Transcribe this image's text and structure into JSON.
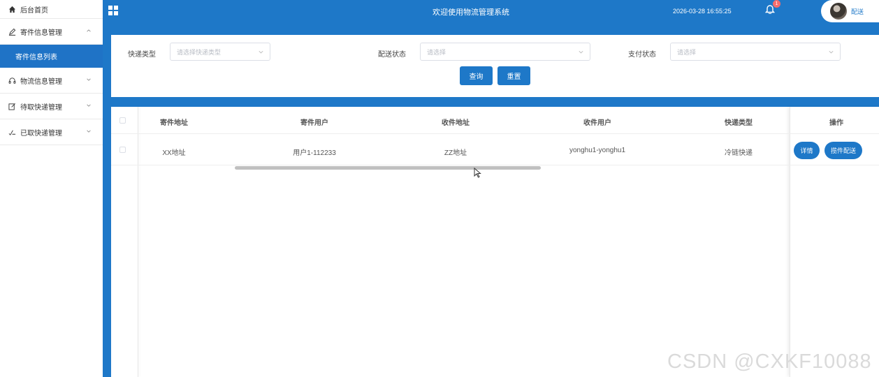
{
  "sidebar": {
    "home": "后台首页",
    "groups": [
      {
        "label": "寄件信息管理",
        "icon": "pen-icon",
        "expanded": true,
        "sub": "寄件信息列表"
      },
      {
        "label": "物流信息管理",
        "icon": "headset-icon"
      },
      {
        "label": "待取快递管理",
        "icon": "edit-icon"
      },
      {
        "label": "已取快递管理",
        "icon": "signature-icon"
      }
    ]
  },
  "header": {
    "title": "欢迎使用物流管理系统",
    "datetime": "2026-03-28 16:55:25",
    "badge": "1",
    "username": "配送"
  },
  "search": {
    "fields": [
      {
        "label": "快递类型",
        "placeholder": "请选择快递类型"
      },
      {
        "label": "配送状态",
        "placeholder": "请选择"
      },
      {
        "label": "支付状态",
        "placeholder": "请选择"
      }
    ],
    "query_btn": "查询",
    "reset_btn": "重置"
  },
  "table": {
    "columns": [
      "寄件地址",
      "寄件用户",
      "收件地址",
      "收件用户",
      "快递类型",
      "操作"
    ],
    "rows": [
      [
        "XX地址",
        "用户1-112233",
        "ZZ地址",
        "yonghu1-yonghu1",
        "冷链快递"
      ]
    ],
    "actions": [
      "详情",
      "揽件配送"
    ]
  },
  "watermark": "CSDN @CXKF10088",
  "colors": {
    "primary": "#1e78c8",
    "sub_active": "#1f73c6",
    "badge": "#f56c6c"
  }
}
